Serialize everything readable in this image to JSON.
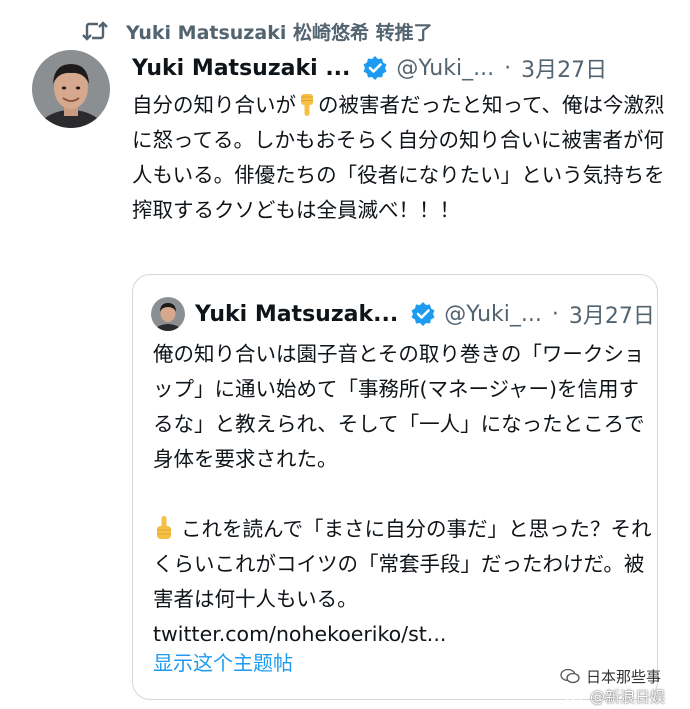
{
  "retweet": {
    "icon": "retweet-icon",
    "text": "Yuki Matsuzaki 松崎悠希 转推了"
  },
  "tweet": {
    "display_name": "Yuki Matsuzaki ...",
    "handle": "@Yuki_...",
    "separator": "·",
    "date": "3月27日",
    "verified_color": "#1d9bf0",
    "text_part1": "自分の知り合いが",
    "emoji": "backhand-index-pointing-down-emoji",
    "text_part2": "の被害者だったと知って、俺は今激烈に怒ってる。しかもおそらく自分の知り合いに被害者が何人もいる。俳優たちの「役者になりたい」という気持ちを搾取するクソどもは全員滅べ！！！"
  },
  "quoted": {
    "display_name": "Yuki Matsuzak...",
    "handle": "@Yuki_...",
    "separator": "·",
    "date": "3月27日",
    "para1": "俺の知り合いは園子音とその取り巻きの「ワークショップ」に通い始めて「事務所(マネージャー)を信用するな」と教えられ、そして「一人」になったところで身体を要求された。",
    "emoji": "backhand-index-pointing-up-emoji",
    "para2": "これを読んで「まさに自分の事だ」と思った？それくらいこれがコイツの「常套手段」だったわけだ。被害者は何十人もいる。",
    "link": "twitter.com/nohekoeriko/st...",
    "show_thread": "显示这个主题帖"
  },
  "watermark": {
    "line1": "日本那些事",
    "line2": "@新浪日娱"
  }
}
